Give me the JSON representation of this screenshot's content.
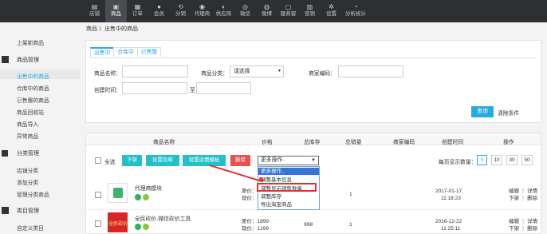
{
  "topnav": [
    {
      "label": "店铺",
      "icon": "store-icon"
    },
    {
      "label": "商品",
      "icon": "goods-icon",
      "active": true
    },
    {
      "label": "订单",
      "icon": "order-icon"
    },
    {
      "label": "会员",
      "icon": "member-icon"
    },
    {
      "label": "分销",
      "icon": "distribution-icon"
    },
    {
      "label": "代理商",
      "icon": "agent-icon"
    },
    {
      "label": "供应商",
      "icon": "supplier-icon"
    },
    {
      "label": "微信",
      "icon": "wechat-icon"
    },
    {
      "label": "微博",
      "icon": "weibo-icon"
    },
    {
      "label": "服务窗",
      "icon": "service-window-icon"
    },
    {
      "label": "营销",
      "icon": "marketing-icon"
    },
    {
      "label": "设置",
      "icon": "settings-icon"
    },
    {
      "label": "分析统计",
      "icon": "analytics-icon"
    }
  ],
  "sidebar": {
    "top_item": "上架新商品",
    "group1": "商品管理",
    "items1": [
      "出售中的商品",
      "仓库中的商品",
      "已售罄的商品",
      "商品回收站",
      "商品导入",
      "异常商品"
    ],
    "group2": "分类管理",
    "items2": [
      "店铺分类",
      "添加分类",
      "管理分类商品"
    ],
    "group3": "类目管理",
    "items3": [
      "自定义类目"
    ]
  },
  "breadcrumb": "商品 〉出售中的商品",
  "tabs": [
    "出售中",
    "仓库中",
    "已售罄"
  ],
  "filters": {
    "name_label": "商品名称：",
    "category_label": "商品分类：",
    "category_value": "请选择",
    "code_label": "商家编码：",
    "time_label": "创建时间：",
    "time_sep": "至",
    "search": "查询",
    "clear": "清除条件"
  },
  "table_headers": [
    "商品名称",
    "价格",
    "总库存",
    "总销量",
    "商家编码",
    "创建时间",
    "操作"
  ],
  "toolbar": {
    "select_all": "全选",
    "btn_shelf": "下架",
    "btn_shipping": "设置包邮",
    "btn_template": "设置运费模板",
    "btn_delete": "删除",
    "more_ops": "更多操作..",
    "per_page_label": "每页显示数量：",
    "per_page_options": [
      "5",
      "10",
      "30",
      "50"
    ]
  },
  "dropdown_options": [
    "更多操作..",
    "调整基本信息",
    "调整显示销售数量",
    "调整库存",
    "导出淘宝商品"
  ],
  "rows": [
    {
      "title": "代理商模块",
      "price_original": "原价：",
      "price_current": "现价：",
      "stock": "",
      "sales": "1",
      "date": "2017-01-17",
      "time": "11:18:23",
      "ops1": "编辑 ｜ 详情",
      "ops2": "下架 ｜ 删除"
    },
    {
      "title": "全民砍价-微信砍价工具",
      "price_original": "原价：1899",
      "price_current": "现价：1299",
      "stock": "998",
      "sales": "1",
      "date": "2016-12-22",
      "time": "11:25:11",
      "ops1": "编辑 ｜ 详情",
      "ops2": "下架 ｜ 删除",
      "image_text": "全民砍价"
    }
  ]
}
